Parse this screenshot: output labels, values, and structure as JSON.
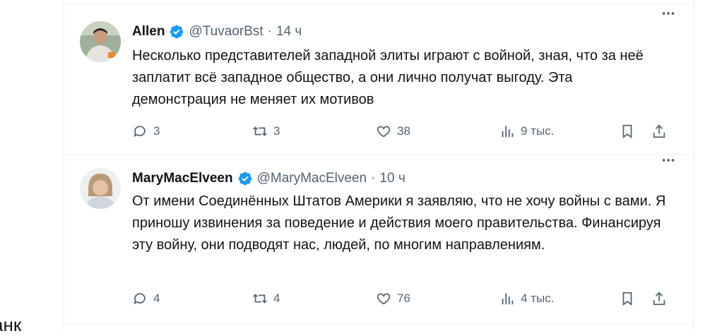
{
  "tweets": [
    {
      "name": "Allen",
      "handle": "@TuvaorBst",
      "dot": "·",
      "time": "14 ч",
      "text": "Несколько представителей западной элиты играют с войной, зная, что за неё заплатит всё западное общество, а они лично получат выгоду. Эта демонстрация не меняет их мотивов",
      "replies": "3",
      "reposts": "3",
      "likes": "38",
      "views": "9 тыс."
    },
    {
      "name": "MaryMacElveen",
      "handle": "@MaryMacElveen",
      "dot": "·",
      "time": "10 ч",
      "text": "От имени Соединённых Штатов Америки я заявляю, что не хочу войны с вами. Я приношу извинения за поведение и действия моего правительства. Финансируя эту войну, они подводят нас, людей, по многим направлениям.",
      "replies": "4",
      "reposts": "4",
      "likes": "76",
      "views": "4 тыс."
    }
  ],
  "left_edge_text": "анк",
  "colors": {
    "verified": "#1d9bf0",
    "secondary": "#536471",
    "divider": "#eff3f4"
  }
}
